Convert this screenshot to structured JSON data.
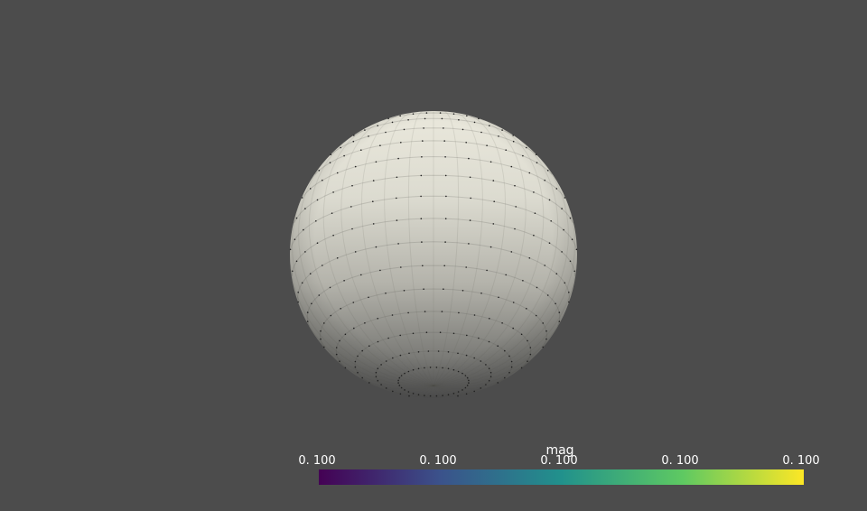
{
  "scene": {
    "background_color": "#4c4c4c",
    "object": "sphere",
    "surface_color": "#e6e4d8",
    "point_color": "#202020"
  },
  "colorbar": {
    "title": "mag",
    "colormap": "viridis",
    "colors": [
      "#440154",
      "#3b528b",
      "#21918c",
      "#5ec962",
      "#fde725"
    ],
    "tick_labels": [
      "0. 100",
      "0. 100",
      "0. 100",
      "0. 100",
      "0. 100"
    ]
  }
}
